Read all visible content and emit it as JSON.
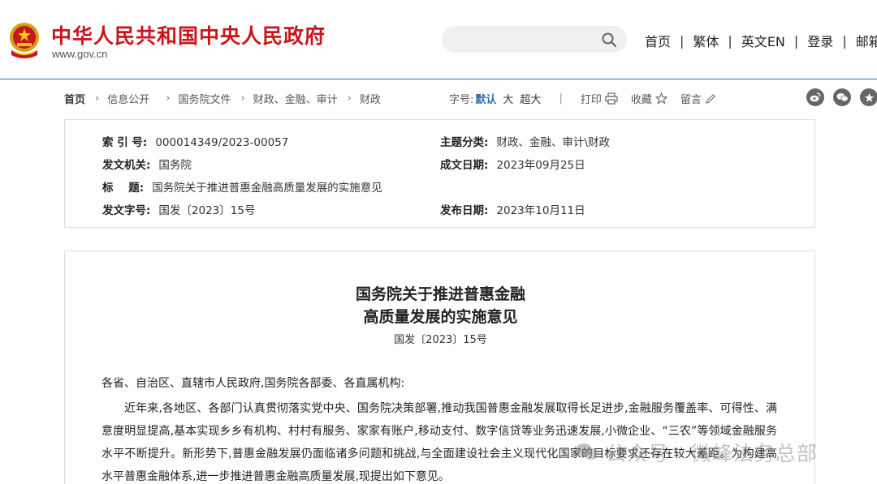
{
  "header": {
    "site_title": "中华人民共和国中央人民政府",
    "site_url": "www.gov.cn",
    "search": {
      "placeholder": "",
      "value": ""
    },
    "nav": [
      "首页",
      "繁体",
      "英文EN",
      "登录",
      "邮箱"
    ]
  },
  "breadcrumb": {
    "home": "首页",
    "items": [
      "信息公开",
      "国务院文件",
      "财政、金融、审计",
      "财政"
    ]
  },
  "tools": {
    "font_size_label": "字号:",
    "font_default": "默认",
    "font_large": "大",
    "font_xlarge": "超大",
    "print": "打印",
    "favorite": "收藏",
    "comment": "留言"
  },
  "info": {
    "index_key": "索 引 号:",
    "index_val": "000014349/2023-00057",
    "category_key": "主题分类:",
    "category_val": "财政、金融、审计\\财政",
    "issuer_key": "发文机关:",
    "issuer_val": "国务院",
    "date_written_key": "成文日期:",
    "date_written_val": "2023年09月25日",
    "title_key": "标    题:",
    "title_val": "国务院关于推进普惠金融高质量发展的实施意见",
    "doc_no_key": "发文字号:",
    "doc_no_val": "国发〔2023〕15号",
    "publish_key": "发布日期:",
    "publish_val": "2023年10月11日"
  },
  "document": {
    "title_line1": "国务院关于推进普惠金融",
    "title_line2": "高质量发展的实施意见",
    "doc_number": "国发〔2023〕15号",
    "salutation": "各省、自治区、直辖市人民政府,国务院各部委、各直属机构:",
    "paragraph1": "近年来,各地区、各部门认真贯彻落实党中央、国务院决策部署,推动我国普惠金融发展取得长足进步,金融服务覆盖率、可得性、满意度明显提高,基本实现乡乡有机构、村村有服务、家家有账户,移动支付、数字信贷等业务迅速发展,小微企业、“三农”等领域金融服务水平不断提升。新形势下,普惠金融发展仍面临诸多问题和挑战,与全面建设社会主义现代化国家的目标要求还存在较大差距。为构建高水平普惠金融体系,进一步推进普惠金融高质量发展,现提出如下意见。"
  },
  "watermark": {
    "text": "公众号 · 微峰法务总部"
  },
  "colors": {
    "brand_red": "#c8161d",
    "accent_blue": "#2b6cb8"
  }
}
